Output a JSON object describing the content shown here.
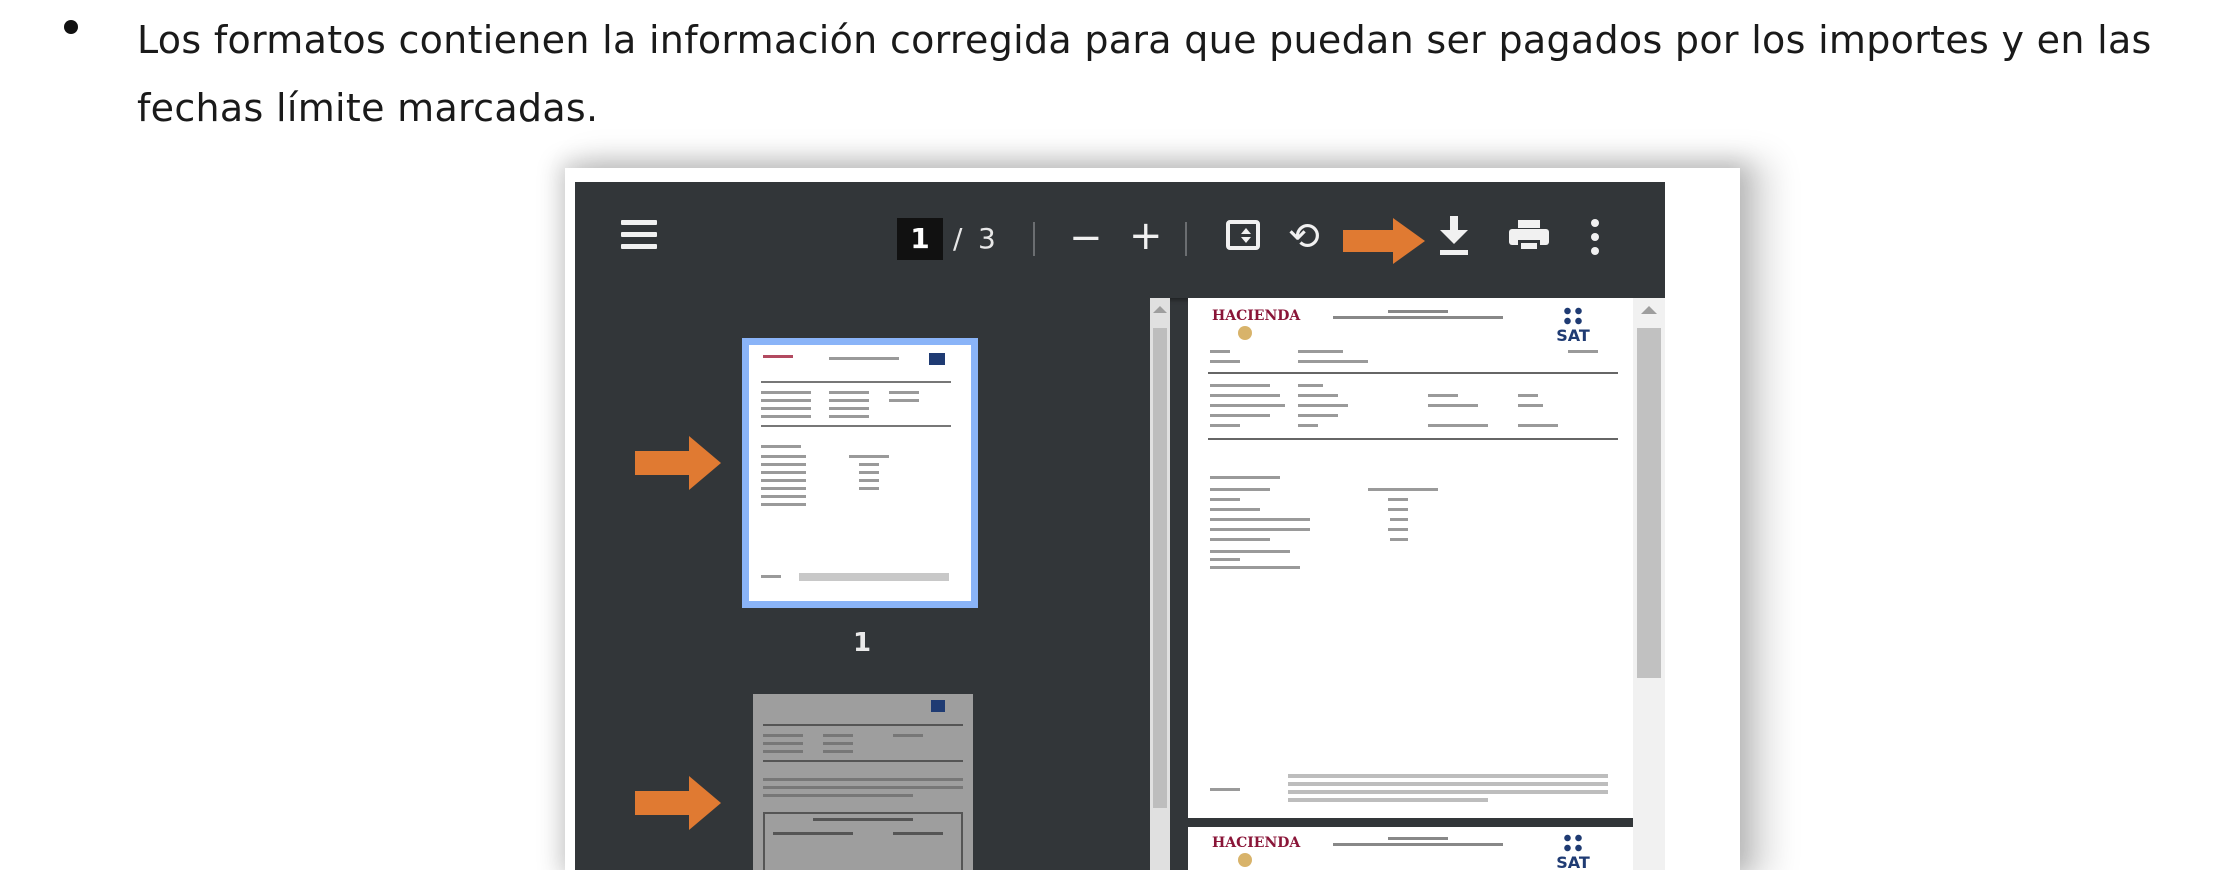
{
  "bullet": {
    "text": "Los formatos contienen la información corregida para que puedan ser pagados por los importes y en las fechas límite marcadas."
  },
  "viewer": {
    "current_page": "1",
    "page_separator": "/",
    "total_pages": "3",
    "zoom_out_label": "−",
    "zoom_in_label": "+",
    "rotate_glyph": "⟲",
    "thumbnail_label": "1",
    "toolbar_icons": [
      "menu-icon",
      "fit-page-icon",
      "rotate-icon",
      "download-icon",
      "print-icon",
      "more-options-icon"
    ]
  },
  "document": {
    "issuer": "HACIENDA",
    "logo": "SAT"
  },
  "colors": {
    "viewer_bg": "#323639",
    "arrow": "#e07a32",
    "thumb_selected": "#8ab4f8"
  }
}
